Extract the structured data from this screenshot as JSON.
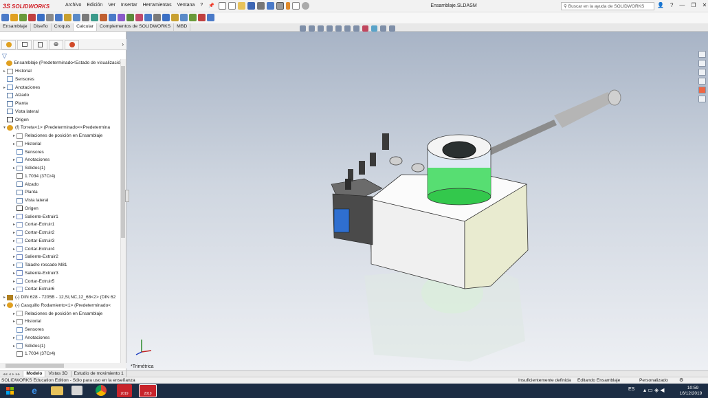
{
  "app": {
    "logo_ds": "3S",
    "logo_name": "SOLIDWORKS",
    "document_title": "Ensamblaje.SLDASM",
    "search_placeholder": "Buscar en la ayuda de SOLIDWORKS"
  },
  "menu": [
    "Archivo",
    "Edición",
    "Ver",
    "Insertar",
    "Herramientas",
    "Ventana",
    "?"
  ],
  "command_tabs": [
    {
      "label": "Ensamblaje",
      "active": false
    },
    {
      "label": "Diseño",
      "active": false
    },
    {
      "label": "Croquis",
      "active": false
    },
    {
      "label": "Calcular",
      "active": true
    },
    {
      "label": "Complementos de SOLIDWORKS",
      "active": false
    },
    {
      "label": "MBD",
      "active": false
    }
  ],
  "feature_tree": [
    {
      "level": 0,
      "expander": "",
      "icon": "assembly-icon",
      "label": "Ensamblaje  (Predeterminado<Estado de visualizació"
    },
    {
      "level": 0,
      "expander": "▸",
      "icon": "history-icon",
      "label": "Historial"
    },
    {
      "level": 0,
      "expander": "",
      "icon": "sensor-icon",
      "label": "Sensores"
    },
    {
      "level": 0,
      "expander": "▸",
      "icon": "annotation-icon",
      "label": "Anotaciones"
    },
    {
      "level": 0,
      "expander": "",
      "icon": "plane-icon",
      "label": "Alzado"
    },
    {
      "level": 0,
      "expander": "",
      "icon": "plane-icon",
      "label": "Planta"
    },
    {
      "level": 0,
      "expander": "",
      "icon": "plane-icon",
      "label": "Vista lateral"
    },
    {
      "level": 0,
      "expander": "",
      "icon": "origin-icon",
      "label": "Origen"
    },
    {
      "level": 0,
      "expander": "▾",
      "icon": "part-icon",
      "label": "(f) Torreta<1> (Predeterminado<<Predetermina"
    },
    {
      "level": 1,
      "expander": "▸",
      "icon": "mate-icon",
      "label": "Relaciones de posición en Ensamblaje"
    },
    {
      "level": 1,
      "expander": "▸",
      "icon": "history-icon",
      "label": "Historial"
    },
    {
      "level": 1,
      "expander": "",
      "icon": "sensor-icon",
      "label": "Sensores"
    },
    {
      "level": 1,
      "expander": "▸",
      "icon": "annotation-icon",
      "label": "Anotaciones"
    },
    {
      "level": 1,
      "expander": "▸",
      "icon": "solid-body-icon",
      "label": "Sólidos(1)"
    },
    {
      "level": 1,
      "expander": "",
      "icon": "material-icon",
      "label": "1.7034 (37Cr4)"
    },
    {
      "level": 1,
      "expander": "",
      "icon": "plane-icon",
      "label": "Alzado"
    },
    {
      "level": 1,
      "expander": "",
      "icon": "plane-icon",
      "label": "Planta"
    },
    {
      "level": 1,
      "expander": "",
      "icon": "plane-icon",
      "label": "Vista lateral"
    },
    {
      "level": 1,
      "expander": "",
      "icon": "origin-icon",
      "label": "Origen"
    },
    {
      "level": 1,
      "expander": "▸",
      "icon": "extrude-icon",
      "label": "Saliente-Extruir1"
    },
    {
      "level": 1,
      "expander": "▸",
      "icon": "cut-icon",
      "label": "Cortar-Extruir1"
    },
    {
      "level": 1,
      "expander": "▸",
      "icon": "cut-icon",
      "label": "Cortar-Extruir2"
    },
    {
      "level": 1,
      "expander": "▸",
      "icon": "cut-icon",
      "label": "Cortar-Extruir3"
    },
    {
      "level": 1,
      "expander": "▸",
      "icon": "cut-icon",
      "label": "Cortar-Extruir4"
    },
    {
      "level": 1,
      "expander": "▸",
      "icon": "extrude-icon",
      "label": "Saliente-Extruir2"
    },
    {
      "level": 1,
      "expander": "▸",
      "icon": "hole-icon",
      "label": "Taladro roscado M81"
    },
    {
      "level": 1,
      "expander": "▸",
      "icon": "extrude-icon",
      "label": "Saliente-Extruir3"
    },
    {
      "level": 1,
      "expander": "▸",
      "icon": "cut-icon",
      "label": "Cortar-Extruir5"
    },
    {
      "level": 1,
      "expander": "▸",
      "icon": "cut-icon",
      "label": "Cortar-Extruir6"
    },
    {
      "level": 0,
      "expander": "▸",
      "icon": "bolt-icon",
      "label": "(-) DIN 628 - 7205B - 12,SI,NC,12_68<2> (DIN 62"
    },
    {
      "level": 0,
      "expander": "▾",
      "icon": "part-icon",
      "label": "(-) Casquillo Rodamiento<1> (Predeterminado<"
    },
    {
      "level": 1,
      "expander": "▸",
      "icon": "mate-icon",
      "label": "Relaciones de posición en Ensamblaje"
    },
    {
      "level": 1,
      "expander": "▸",
      "icon": "history-icon",
      "label": "Historial"
    },
    {
      "level": 1,
      "expander": "",
      "icon": "sensor-icon",
      "label": "Sensores"
    },
    {
      "level": 1,
      "expander": "▸",
      "icon": "annotation-icon",
      "label": "Anotaciones"
    },
    {
      "level": 1,
      "expander": "▸",
      "icon": "solid-body-icon",
      "label": "Sólidos(1)"
    },
    {
      "level": 1,
      "expander": "",
      "icon": "material-icon",
      "label": "1.7034 (37Cr4)"
    }
  ],
  "viewport": {
    "view_name": "*Trimétrica"
  },
  "bottom_tabs": [
    {
      "label": "Modelo",
      "active": true
    },
    {
      "label": "Vistas 3D",
      "active": false
    },
    {
      "label": "Estudio de movimiento 1",
      "active": false
    }
  ],
  "status": {
    "edition": "SOLIDWORKS Education Edition - Sólo para uso en la enseñanza",
    "definition": "Insuficientemente definida",
    "mode": "Editando Ensamblaje",
    "custom": "Personalizado"
  },
  "taskbar": {
    "language": "ES",
    "time": "10:59",
    "date": "16/12/2019",
    "sw_badge": "2019"
  },
  "colors": {
    "brand_red": "#d2232a",
    "taskbar_bg": "#1c2d44",
    "viewport_top": "#a8b4c6",
    "part_body": "#ffffff",
    "bearing_green": "#3fdc5a",
    "block_dark": "#4a4a4a",
    "blue_part": "#2f6fd0"
  }
}
